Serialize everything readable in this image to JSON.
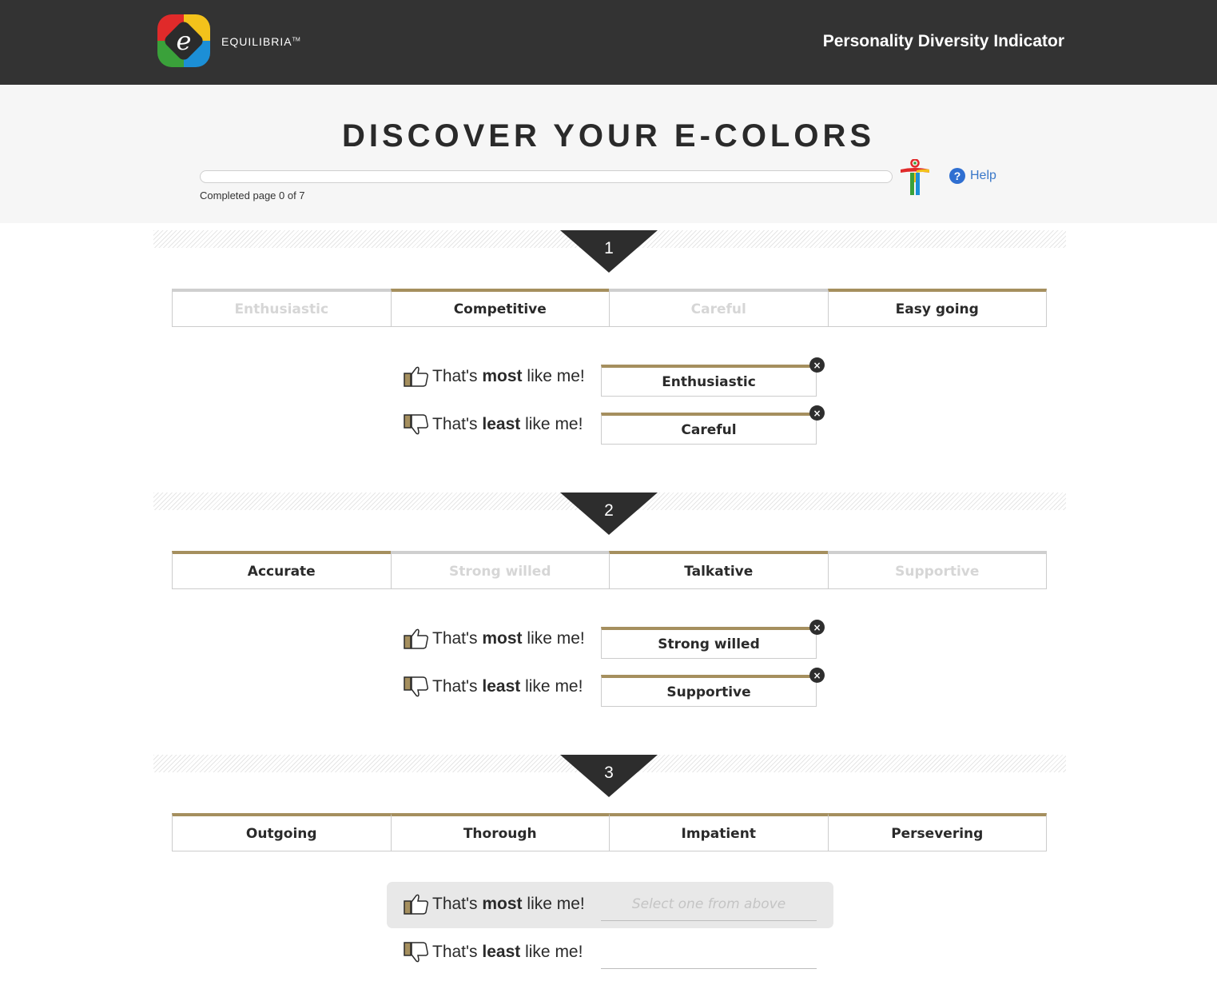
{
  "header": {
    "brand": "EQUILIBRIA",
    "brand_tm": "TM",
    "app_title": "Personality Diversity Indicator"
  },
  "hero": {
    "title": "DISCOVER YOUR E-COLORS",
    "progress_fraction": 0,
    "progress_text": "Completed page 0 of 7",
    "help_label": "Help",
    "help_glyph": "?"
  },
  "labels": {
    "most_prefix": "That's ",
    "most_bold": "most",
    "most_suffix": " like me!",
    "least_prefix": "That's ",
    "least_bold": "least",
    "least_suffix": " like me!",
    "remove_glyph": "×"
  },
  "questions": [
    {
      "number": "1",
      "options": [
        {
          "label": "Enthusiastic",
          "used": true
        },
        {
          "label": "Competitive",
          "used": false
        },
        {
          "label": "Careful",
          "used": true
        },
        {
          "label": "Easy going",
          "used": false
        }
      ],
      "most": "Enthusiastic",
      "least": "Careful"
    },
    {
      "number": "2",
      "options": [
        {
          "label": "Accurate",
          "used": false
        },
        {
          "label": "Strong willed",
          "used": true
        },
        {
          "label": "Talkative",
          "used": false
        },
        {
          "label": "Supportive",
          "used": true
        }
      ],
      "most": "Strong willed",
      "least": "Supportive"
    },
    {
      "number": "3",
      "options": [
        {
          "label": "Outgoing",
          "used": false
        },
        {
          "label": "Thorough",
          "used": false
        },
        {
          "label": "Impatient",
          "used": false
        },
        {
          "label": "Persevering",
          "used": false
        }
      ],
      "most_placeholder": "Select one from above"
    }
  ],
  "colors": {
    "topbar": "#333333",
    "accent": "#a58f5e",
    "help": "#2f6fd1"
  }
}
